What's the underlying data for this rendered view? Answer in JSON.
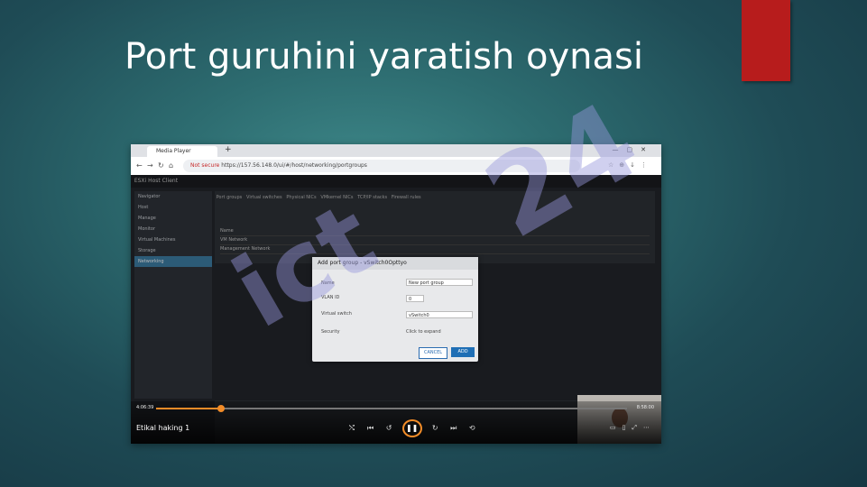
{
  "slide": {
    "title": "Port guruhini yaratish oynasi"
  },
  "browser": {
    "tab_title": "Media Player",
    "not_secure": "Not secure",
    "url": "https://157.56.148.0/ui/#/host/networking/portgroups"
  },
  "app": {
    "name": "ESXi Host Client",
    "menu": [
      "Navigator",
      "Host",
      "Manage",
      "Monitor",
      "Virtual Machines",
      "Storage",
      "Networking"
    ]
  },
  "tabs": [
    "Port groups",
    "Virtual switches",
    "Physical NICs",
    "VMkernel NICs",
    "TCP/IP stacks",
    "Firewall rules"
  ],
  "grid_rows": [
    "Name",
    "VM Network",
    "Management Network"
  ],
  "modal": {
    "title": "Add port group - vSwitch0Opttyo",
    "name_label": "Name",
    "name_value": "New port group",
    "vlan_label": "VLAN ID",
    "vlan_value": "0",
    "vswitch_label": "Virtual switch",
    "vswitch_value": "vSwitch0",
    "security_label": "Security",
    "security_value": "Click to expand",
    "cancel": "CANCEL",
    "add": "ADD"
  },
  "player": {
    "time_current": "4:06:39",
    "time_total": "8:58:00",
    "video_title": "Etikal haking 1",
    "progress": 0.137
  },
  "colors": {
    "accent": "#b71c1c",
    "progress": "#f28c28",
    "button": "#1f6fb5"
  }
}
